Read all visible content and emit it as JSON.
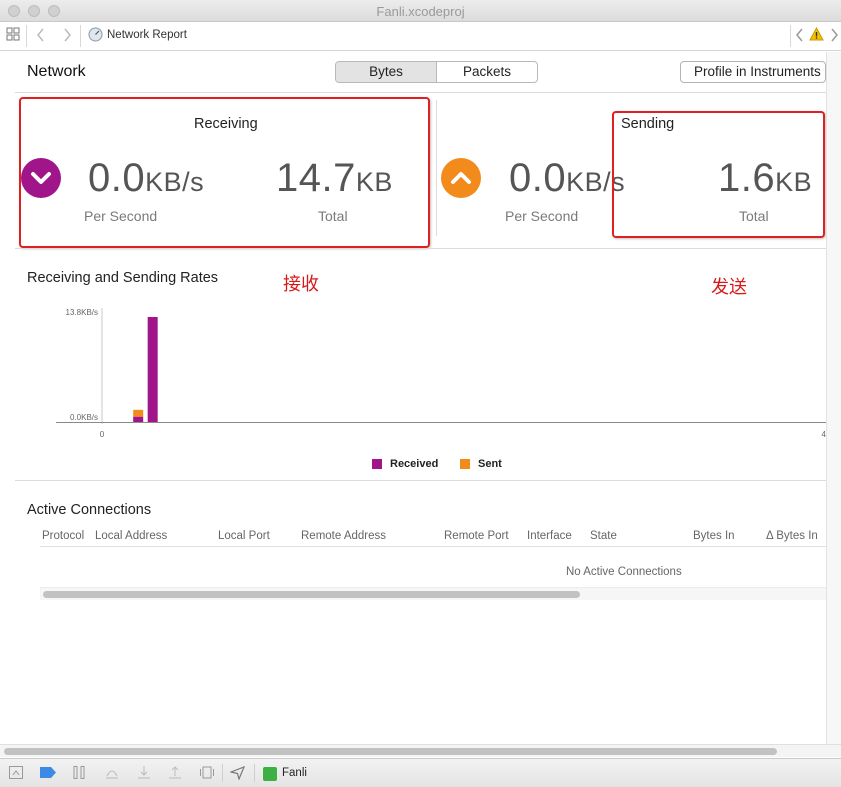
{
  "window": {
    "title": "Fanli.xcodeproj"
  },
  "jumpbar": {
    "breadcrumb": "Network Report",
    "warning_icon": "warning-icon"
  },
  "header": {
    "title": "Network",
    "tabs": [
      {
        "label": "Bytes",
        "selected": true
      },
      {
        "label": "Packets",
        "selected": false
      }
    ],
    "profile_button": "Profile in Instruments"
  },
  "receiving": {
    "title": "Receiving",
    "rate_value": "0.0",
    "rate_unit": "KB/s",
    "rate_label": "Per Second",
    "total_value": "14.7",
    "total_unit": "KB",
    "total_label": "Total",
    "color": "#a0158a"
  },
  "sending": {
    "title": "Sending",
    "rate_value": "0.0",
    "rate_unit": "KB/s",
    "rate_label": "Per Second",
    "total_value": "1.6",
    "total_unit": "KB",
    "total_label": "Total",
    "color": "#f28a1c"
  },
  "annotations": {
    "receive_cn": "接收",
    "send_cn": "发送",
    "highlight_color": "#e02020"
  },
  "rates_chart": {
    "title": "Receiving and Sending Rates",
    "legend": [
      {
        "label": "Received",
        "color": "#a0158a"
      },
      {
        "label": "Sent",
        "color": "#f28a1c"
      }
    ]
  },
  "chart_data": {
    "type": "bar",
    "title": "Receiving and Sending Rates",
    "y_tick_labels": [
      "13.8KB/s",
      "0.0KB/s"
    ],
    "x_tick_labels": [
      "0",
      "4"
    ],
    "ylim": [
      0,
      13.8
    ],
    "xlim": [
      0,
      4
    ],
    "grid": false,
    "legend_position": "bottom-center",
    "series": [
      {
        "name": "Received",
        "color": "#a0158a",
        "points": [
          {
            "x": 0.2,
            "y": 0.7
          },
          {
            "x": 0.28,
            "y": 13.8
          }
        ]
      },
      {
        "name": "Sent",
        "color": "#f28a1c",
        "points": [
          {
            "x": 0.2,
            "y": 1.6
          }
        ]
      }
    ]
  },
  "connections": {
    "title": "Active Connections",
    "columns": [
      "Protocol",
      "Local Address",
      "Local Port",
      "Remote Address",
      "Remote Port",
      "Interface",
      "State",
      "Bytes In",
      "Δ Bytes In"
    ],
    "empty_message": "No Active Connections",
    "scroll_fraction": 0.69
  },
  "debugbar": {
    "target": "Fanli"
  }
}
